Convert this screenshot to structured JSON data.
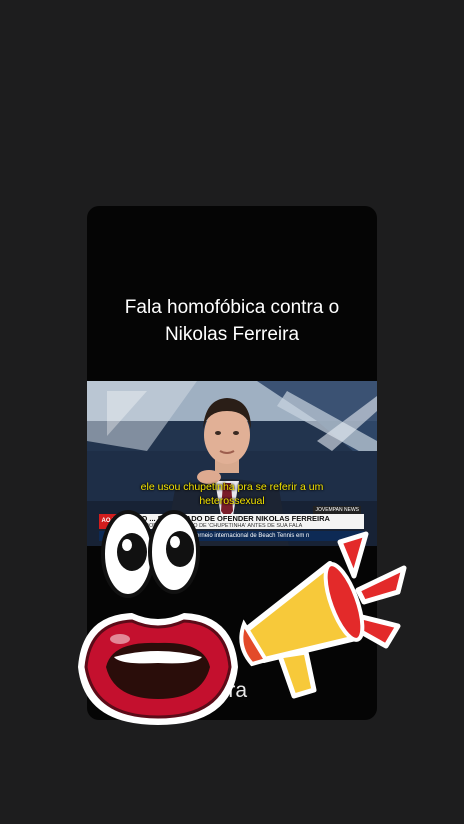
{
  "post": {
    "headline_line1": "Fala homofóbica contra o",
    "headline_line2": "Nikolas Ferreira",
    "bottom_caption_fragment": "reira"
  },
  "video": {
    "subtitle_line1": "ele usou chupetinha pra se referir a um",
    "subtitle_line2": "heterossexual",
    "ticker_live_label": "AO VIVO",
    "ticker_headline": "LTO ... É ACUSADO DE OFENDER NIKOLAS FERREIRA",
    "ticker_subheadline": "DOR FOI CHAMADO DE 'CHUPETINHA' ANTES DE SUA FALA",
    "ticker_brand": "JOVEMPAN NEWS",
    "ticker_bottom": "Salvador recebe torneio internacional de Beach Tennis em n"
  },
  "stickers": {
    "eyes": "eyes-icon",
    "mouth": "mouth-icon",
    "megaphone": "megaphone-icon"
  },
  "colors": {
    "background": "#1d1d1e",
    "card": "#050505",
    "subtitle": "#f2e200",
    "lips": "#c4102e",
    "megaphone": "#f7c93a"
  }
}
